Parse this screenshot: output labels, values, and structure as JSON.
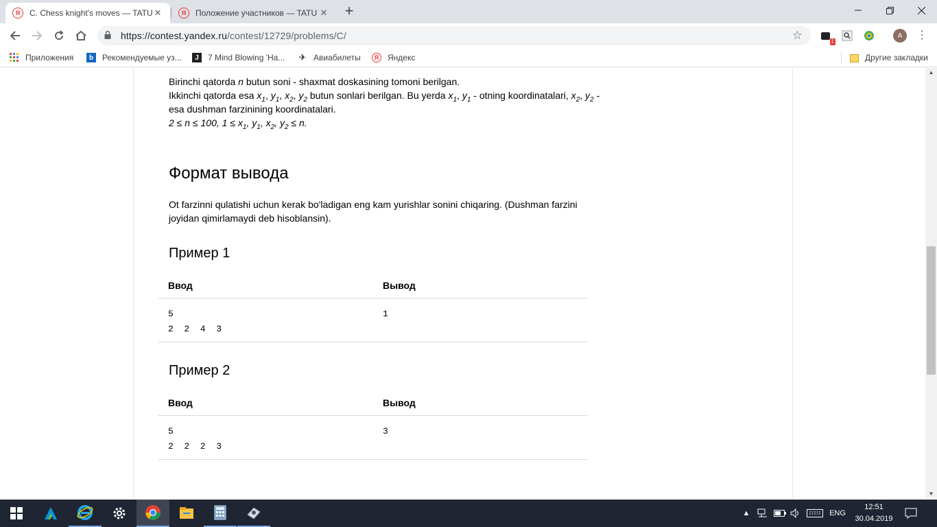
{
  "browser": {
    "tabs": [
      {
        "title": "C. Chess knight's moves — TATU",
        "favicon": "Я",
        "active": true
      },
      {
        "title": "Положение участников — TATU",
        "favicon": "Я",
        "active": false
      }
    ],
    "url_host": "https://contest.yandex.ru",
    "url_path": "/contest/12729/problems/C/",
    "bookmarks": [
      {
        "label": "Приложения",
        "icon": "apps-grid-icon"
      },
      {
        "label": "Рекомендуемые уз...",
        "icon": "bing-icon"
      },
      {
        "label": "7 Mind Blowing 'Ha...",
        "icon": "bookmark-page-icon"
      },
      {
        "label": "Авиабилеты",
        "icon": "plane-icon"
      },
      {
        "label": "Яндекс",
        "icon": "yandex-icon"
      }
    ],
    "other_bookmarks": "Другие закладки",
    "extension_badge": "1",
    "avatar_letter": "A"
  },
  "problem": {
    "input_line1_a": "Birinchi qatorda ",
    "input_n": "n",
    "input_line1_b": " butun soni - shaxmat doskasining tomoni berilgan.",
    "input_line2_a": "Ikkinchi qatorda esa ",
    "input_line2_b": " butun sonlari berilgan. Bu yerda ",
    "input_line2_c": " - otning koordinatalari, ",
    "input_line2_d": " - esa dushman farzinining koordinatalari.",
    "constraint_a": "2 ≤ ",
    "constraint_b": " ≤ 100, 1 ≤ ",
    "constraint_c": " ≤ ",
    "constraint_d": ".",
    "var_x": "x",
    "var_y": "y",
    "sub_1": "1",
    "sub_2": "2",
    "comma": ", ",
    "output_heading": "Формат вывода",
    "output_text": "Ot farzinni qulatishi uchun kerak bo'ladigan eng kam yurishlar sonini chiqaring. (Dushman farzini joyidan qimirlamaydi deb hisoblansin).",
    "examples": [
      {
        "title": "Пример 1",
        "input_label": "Ввод",
        "output_label": "Вывод",
        "input": "5\n2 2 4 3",
        "output": "1"
      },
      {
        "title": "Пример 2",
        "input_label": "Ввод",
        "output_label": "Вывод",
        "input": "5\n2 2 2 3",
        "output": "3"
      }
    ]
  },
  "taskbar": {
    "apps": [
      "start-icon",
      "autodesk-icon",
      "internet-explorer-icon",
      "settings-icon",
      "chrome-icon",
      "file-explorer-icon",
      "calculator-icon",
      "app-icon"
    ],
    "language": "ENG",
    "time": "12:51",
    "date": "30.04.2019"
  }
}
